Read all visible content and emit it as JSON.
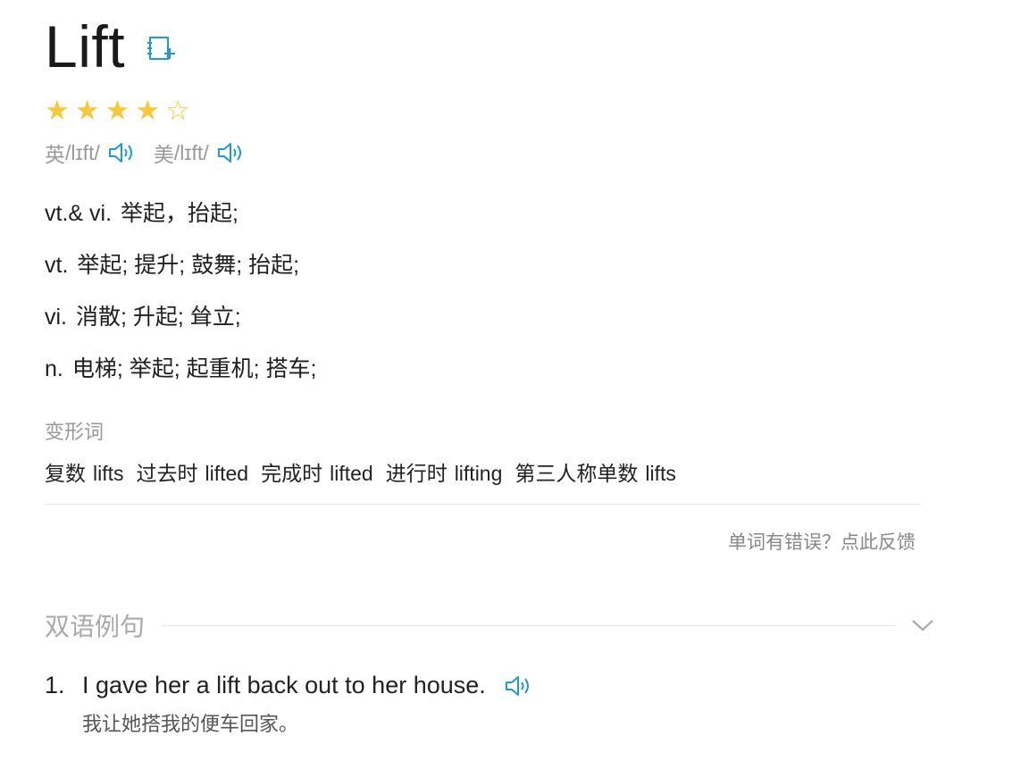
{
  "entry": {
    "word": "Lift",
    "add_icon": "add-to-wordbook-icon",
    "rating": 4,
    "rating_max": 5,
    "star_full": "★",
    "star_empty": "☆"
  },
  "phonetics": [
    {
      "region": "英",
      "ipa": "/lɪft/",
      "icon": "speaker-icon"
    },
    {
      "region": "美",
      "ipa": "/lɪft/",
      "icon": "speaker-icon"
    }
  ],
  "definitions": [
    {
      "pos": "vt.& vi.",
      "meaning": "举起，抬起;"
    },
    {
      "pos": "vt.",
      "meaning": "举起; 提升; 鼓舞; 抬起;"
    },
    {
      "pos": "vi.",
      "meaning": "消散; 升起; 耸立;"
    },
    {
      "pos": "n.",
      "meaning": "电梯; 举起; 起重机; 搭车;"
    }
  ],
  "word_forms": {
    "label": "变形词",
    "items": [
      {
        "name": "复数",
        "value": "lifts"
      },
      {
        "name": "过去时",
        "value": "lifted"
      },
      {
        "name": "完成时",
        "value": "lifted"
      },
      {
        "name": "进行时",
        "value": "lifting"
      },
      {
        "name": "第三人称单数",
        "value": "lifts"
      }
    ]
  },
  "feedback": "单词有错误？点此反馈",
  "examples_section": {
    "title": "双语例句",
    "toggle_icon": "chevron-down-icon",
    "items": [
      {
        "num": "1.",
        "en": "I gave her a lift back out to her house.",
        "cn": "我让她搭我的便车回家。"
      }
    ]
  },
  "colors": {
    "accent": "#1a9bd7",
    "star": "#f7c83a",
    "muted": "#999999"
  }
}
